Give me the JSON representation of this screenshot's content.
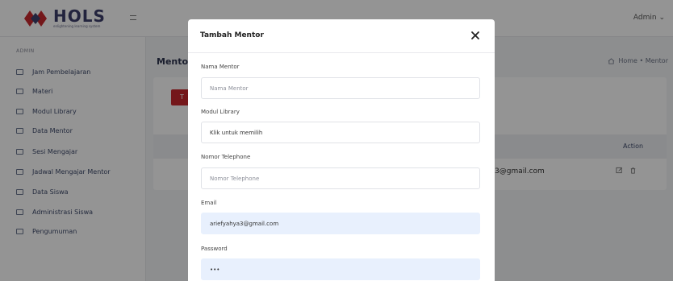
{
  "header": {
    "logo_title": "HOLS",
    "logo_subtitle": "enlightening learning system",
    "admin_label": "Admin ⌄"
  },
  "sidebar": {
    "heading": "ADMIN",
    "items": [
      {
        "label": "Jam Pembelajaran"
      },
      {
        "label": "Materi"
      },
      {
        "label": "Modul Library"
      },
      {
        "label": "Data Mentor"
      },
      {
        "label": "Sesi Mengajar"
      },
      {
        "label": "Jadwal Mengajar Mentor"
      },
      {
        "label": "Data Siswa"
      },
      {
        "label": "Administrasi Siswa"
      },
      {
        "label": "Pengumuman"
      }
    ]
  },
  "main": {
    "page_title": "Mento",
    "breadcrumb": "Home • Mentor",
    "add_button_label": "T",
    "table": {
      "action_header": "Action",
      "row_email": "3@gmail.com"
    }
  },
  "modal": {
    "title": "Tambah Mentor",
    "fields": {
      "nama": {
        "label": "Nama Mentor",
        "placeholder": "Nama Mentor",
        "value": ""
      },
      "modul": {
        "label": "Modul Library",
        "value": "Klik untuk memilih"
      },
      "telp": {
        "label": "Nomor Telephone",
        "placeholder": "Nomor Telephone",
        "value": ""
      },
      "email": {
        "label": "Email",
        "value": "ariefyahya3@gmail.com"
      },
      "password": {
        "label": "Password",
        "value": "•••"
      }
    }
  },
  "colors": {
    "brand_red": "#c8282d",
    "autofill_blue": "#e8f0fd"
  }
}
